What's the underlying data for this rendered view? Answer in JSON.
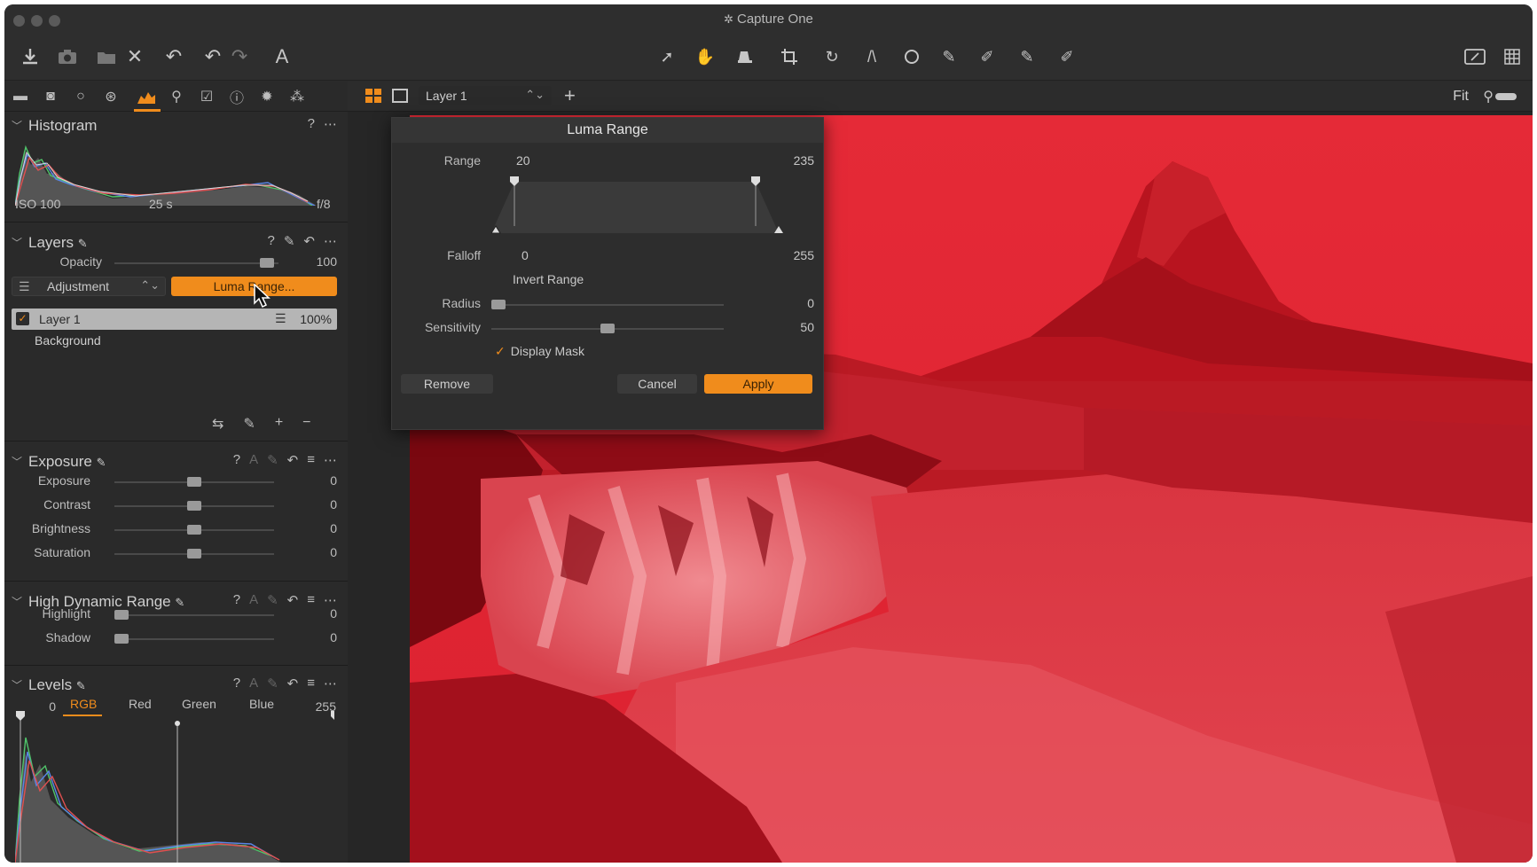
{
  "app": {
    "title": "Capture One",
    "title_icon": "aperture-icon"
  },
  "toolbar": {
    "left_icons": [
      "import-icon",
      "camera-icon",
      "folder-icon",
      "close-icon",
      "undo-all-icon",
      "undo-icon",
      "redo-icon",
      "text-icon"
    ],
    "center_icons": [
      "select-cursor-icon",
      "hand-pan-icon",
      "pick-icon",
      "crop-icon",
      "rotate-icon",
      "keystone-icon",
      "circle-icon",
      "brush-icon",
      "eraser-icon",
      "gradient-icon",
      "fill-icon"
    ],
    "right_icons": [
      "compare-icon",
      "grid-icon"
    ],
    "text_glyph": "A"
  },
  "tool_tabs": {
    "icons": [
      "library-icon",
      "capture-icon",
      "lens-icon",
      "color-icon",
      "exposure-icon",
      "details-icon",
      "adjustments-icon",
      "metadata-icon",
      "settings-icon",
      "batch-icon"
    ],
    "active_index": 4
  },
  "histogram": {
    "title": "Histogram",
    "iso": "ISO 100",
    "shutter": "25 s",
    "aperture": "f/8"
  },
  "layers": {
    "title": "Layers",
    "opacity_label": "Opacity",
    "opacity_value": "100",
    "opacity_level": 1.0,
    "adjustment_label": "Adjustment",
    "luma_button": "Luma Range...",
    "items": [
      {
        "name": "Layer 1",
        "percent": "100%"
      },
      {
        "name": "Background"
      }
    ]
  },
  "exposure": {
    "title": "Exposure",
    "sliders": [
      {
        "label": "Exposure",
        "value": "0",
        "level": 0.5
      },
      {
        "label": "Contrast",
        "value": "0",
        "level": 0.5
      },
      {
        "label": "Brightness",
        "value": "0",
        "level": 0.5
      },
      {
        "label": "Saturation",
        "value": "0",
        "level": 0.5
      }
    ]
  },
  "hdr": {
    "title": "High Dynamic Range",
    "sliders": [
      {
        "label": "Highlight",
        "value": "0",
        "level": 0.0
      },
      {
        "label": "Shadow",
        "value": "0",
        "level": 0.0
      }
    ]
  },
  "levels": {
    "title": "Levels",
    "low": "0",
    "high": "255",
    "tabs": [
      "RGB",
      "Red",
      "Green",
      "Blue"
    ],
    "active_tab": "RGB"
  },
  "viewer": {
    "layer_select": "Layer 1",
    "fit_label": "Fit"
  },
  "luma_dialog": {
    "title": "Luma Range",
    "range_label": "Range",
    "range_low": "20",
    "range_high": "235",
    "falloff_label": "Falloff",
    "falloff_low": "0",
    "falloff_high": "255",
    "invert_label": "Invert Range",
    "radius_label": "Radius",
    "radius_value": "0",
    "radius_level": 0.0,
    "sensitivity_label": "Sensitivity",
    "sensitivity_value": "50",
    "sensitivity_level": 0.5,
    "display_mask_label": "Display Mask",
    "display_mask_checked": true,
    "remove_label": "Remove",
    "cancel_label": "Cancel",
    "apply_label": "Apply"
  },
  "colors": {
    "accent": "#f08c1c",
    "mask": "#d61a24",
    "panel": "#2a2a2a"
  }
}
